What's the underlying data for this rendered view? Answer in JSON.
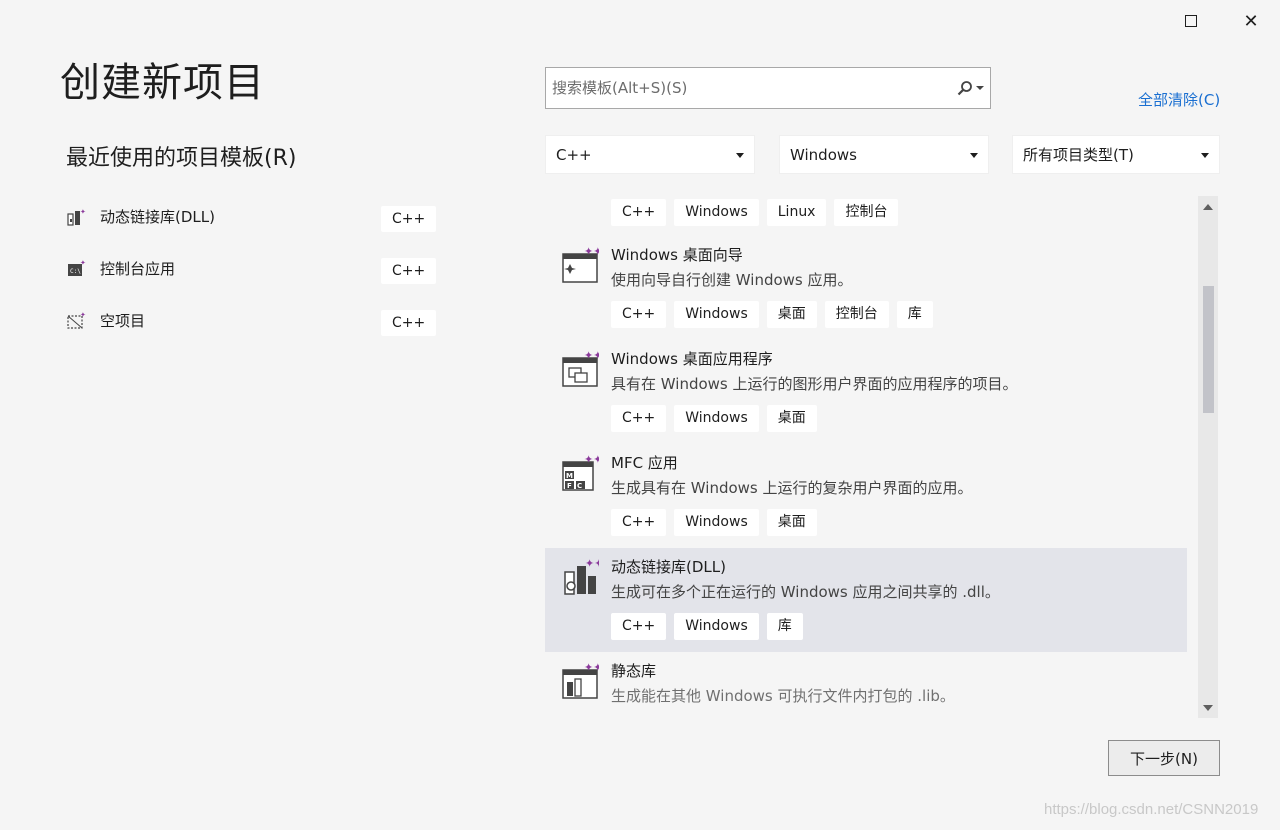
{
  "window": {
    "maximize_icon": "maximize-icon",
    "close_icon": "close-icon",
    "close_glyph": "✕"
  },
  "page_title": "创建新项目",
  "recent": {
    "title": "最近使用的项目模板(R)",
    "items": [
      {
        "label": "动态链接库(DLL)",
        "tag": "C++",
        "icon": "dll-icon"
      },
      {
        "label": "控制台应用",
        "tag": "C++",
        "icon": "console-icon"
      },
      {
        "label": "空项目",
        "tag": "C++",
        "icon": "empty-project-icon"
      }
    ]
  },
  "search": {
    "placeholder": "搜索模板(Alt+S)(S)",
    "icon": "search-icon"
  },
  "clear_all": "全部清除(C)",
  "filters": {
    "language": "C++",
    "platform": "Windows",
    "project_type": "所有项目类型(T)"
  },
  "templates": {
    "first_tags": [
      "C++",
      "Windows",
      "Linux",
      "控制台"
    ],
    "items": [
      {
        "name": "Windows 桌面向导",
        "desc": "使用向导自行创建 Windows 应用。",
        "tags": [
          "C++",
          "Windows",
          "桌面",
          "控制台",
          "库"
        ],
        "icon": "desktop-wizard-icon"
      },
      {
        "name": "Windows 桌面应用程序",
        "desc": "具有在 Windows 上运行的图形用户界面的应用程序的项目。",
        "tags": [
          "C++",
          "Windows",
          "桌面"
        ],
        "icon": "desktop-app-icon"
      },
      {
        "name": "MFC 应用",
        "desc": "生成具有在 Windows 上运行的复杂用户界面的应用。",
        "tags": [
          "C++",
          "Windows",
          "桌面"
        ],
        "icon": "mfc-icon"
      },
      {
        "name": "动态链接库(DLL)",
        "desc": "生成可在多个正在运行的 Windows 应用之间共享的 .dll。",
        "tags": [
          "C++",
          "Windows",
          "库"
        ],
        "icon": "dll-icon"
      },
      {
        "name": "静态库",
        "desc": "生成能在其他 Windows 可执行文件内打包的 .lib。",
        "tags": [],
        "icon": "static-lib-icon"
      }
    ]
  },
  "next_button": "下一步(N)",
  "watermark": "https://blog.csdn.net/CSNN2019",
  "colors": {
    "background": "#f5f5f5",
    "link": "#1a6fd1",
    "selected_row": "#e3e4ea",
    "icon_accent": "#8b3a9b"
  }
}
